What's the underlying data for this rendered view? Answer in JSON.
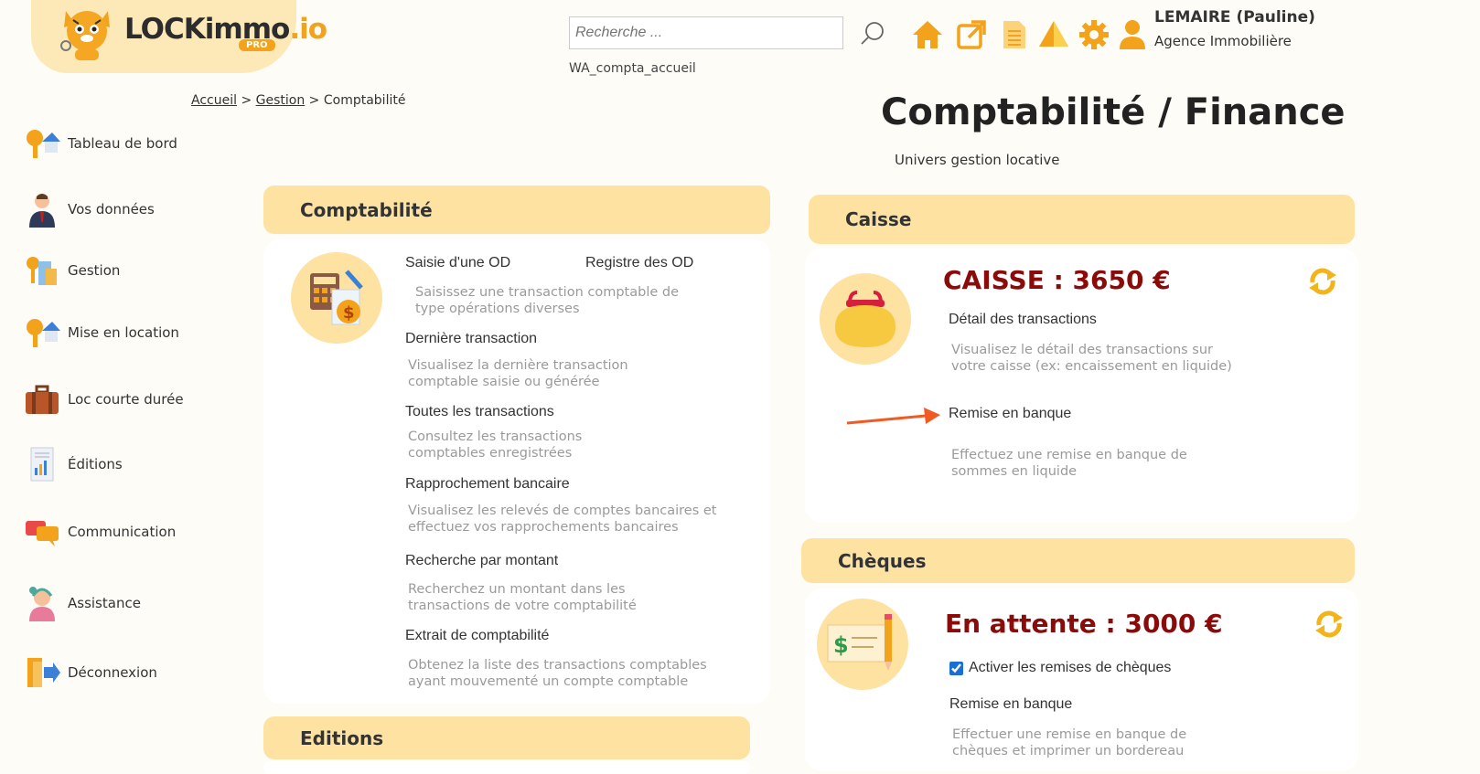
{
  "header": {
    "logo_main": "LOCKimmo",
    "logo_suffix": ".io",
    "logo_badge": "PRO",
    "search_placeholder": "Recherche ...",
    "search_caption": "WA_compta_accueil",
    "user_name": "LEMAIRE (Pauline)",
    "user_role": "Agence Immobilière"
  },
  "breadcrumb": {
    "home": "Accueil",
    "sep1": ">",
    "section": "Gestion",
    "sep2": ">",
    "current": "Comptabilité"
  },
  "page": {
    "title": "Comptabilité / Finance",
    "subtitle": "Univers gestion locative"
  },
  "sidebar": {
    "items": [
      {
        "label": "Tableau de bord",
        "icon": "dashboard-icon"
      },
      {
        "label": "Vos données",
        "icon": "user-icon"
      },
      {
        "label": "Gestion",
        "icon": "gestion-icon"
      },
      {
        "label": "Mise en location",
        "icon": "rental-icon"
      },
      {
        "label": "Loc courte durée",
        "icon": "suitcase-icon"
      },
      {
        "label": "Éditions",
        "icon": "report-icon"
      },
      {
        "label": "Communication",
        "icon": "chat-icon"
      },
      {
        "label": "Assistance",
        "icon": "support-icon"
      },
      {
        "label": "Déconnexion",
        "icon": "logout-icon"
      }
    ]
  },
  "compta": {
    "title": "Comptabilité",
    "links": {
      "saisie": "Saisie d'une OD",
      "registre": "Registre des OD",
      "saisie_desc": "Saisissez une transaction comptable de type opérations diverses",
      "derniere": "Dernière transaction",
      "derniere_desc": "Visualisez la dernière transaction comptable saisie ou générée",
      "toutes": "Toutes les transactions",
      "toutes_desc": "Consultez les transactions comptables enregistrées",
      "rappro": "Rapprochement bancaire",
      "rappro_desc": "Visualisez les relevés de comptes bancaires et effectuez vos rapprochements bancaires",
      "recherche": "Recherche par montant",
      "recherche_desc": "Recherchez un montant dans les transactions de votre comptabilité",
      "extrait": "Extrait de comptabilité",
      "extrait_desc": "Obtenez la liste des transactions comptables ayant mouvementé un compte comptable"
    }
  },
  "editions": {
    "title": "Editions"
  },
  "caisse": {
    "title": "Caisse",
    "amount": "CAISSE : 3650 €",
    "detail": "Détail des transactions",
    "detail_desc": "Visualisez le détail des transactions sur votre caisse (ex: encaissement en liquide)",
    "remise": "Remise en banque",
    "remise_desc": "Effectuez une remise en banque de sommes en liquide"
  },
  "cheques": {
    "title": "Chèques",
    "amount": "En attente : 3000 €",
    "activate": "Activer les remises de chèques",
    "activate_checked": true,
    "remise": "Remise en banque",
    "remise_desc": "Effectuer une remise en banque de chèques et imprimer un bordereau"
  },
  "colors": {
    "accent": "#f3a21b",
    "panel": "#fde2a2",
    "amount": "#8b0a0a",
    "arrow": "#f15a22"
  }
}
